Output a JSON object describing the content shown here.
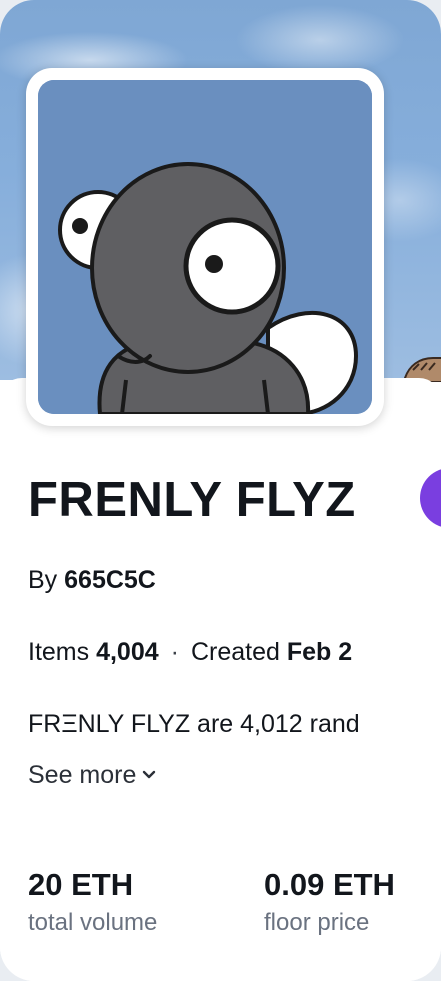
{
  "collection": {
    "title": "FRENLY FLYZ",
    "creator_prefix": "By",
    "creator": "665C5C",
    "items_label": "Items",
    "items_value": "4,004",
    "separator": "·",
    "created_label": "Created",
    "created_value": "Feb 2",
    "description": "FRΞNLY FLYZ are 4,012 rand",
    "see_more": "See more"
  },
  "metrics": [
    {
      "value": "20 ETH",
      "label": "total volume"
    },
    {
      "value": "0.09 ETH",
      "label": "floor price"
    }
  ],
  "icons": {
    "avatar": "frenly-fly-character",
    "see_more": "chevron-down-icon",
    "badge": "verified-badge-icon"
  },
  "colors": {
    "banner_sky": "#86aedb",
    "avatar_bg": "#6a8fbf",
    "badge": "#7a3ee0",
    "text": "#12161c",
    "muted": "#6a7280"
  }
}
